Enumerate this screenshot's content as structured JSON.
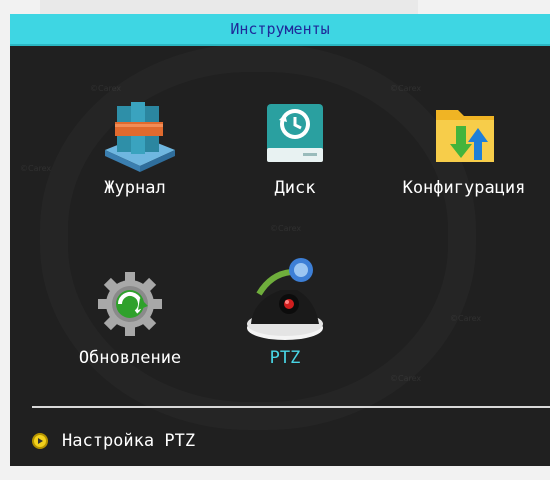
{
  "window": {
    "title": "Инструменты"
  },
  "items": [
    {
      "label": "Журнал",
      "icon": "log-icon",
      "active": false
    },
    {
      "label": "Диск",
      "icon": "disk-icon",
      "active": false
    },
    {
      "label": "Конфигурация",
      "icon": "config-folder-icon",
      "active": false
    },
    {
      "label": "Обновление",
      "icon": "update-gear-icon",
      "active": false
    },
    {
      "label": "PTZ",
      "icon": "ptz-camera-icon",
      "active": true
    }
  ],
  "footer": {
    "hint": "Настройка PTZ",
    "icon": "info-icon"
  },
  "colors": {
    "titlebar": "#3ed6e3",
    "title_text": "#1f2a9a",
    "active_label": "#49d6e6",
    "background": "#202020"
  }
}
